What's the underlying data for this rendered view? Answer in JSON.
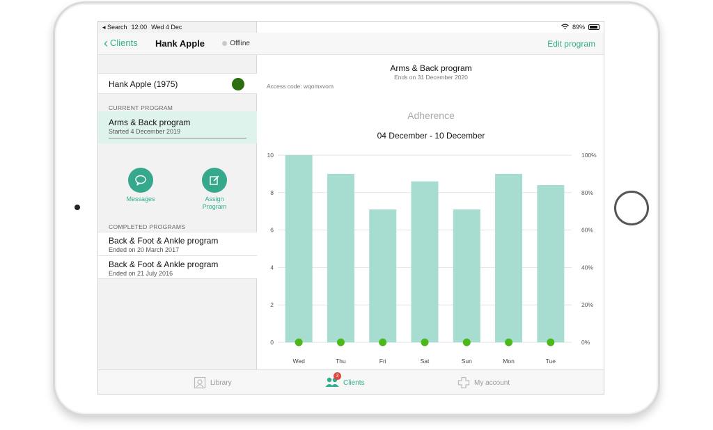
{
  "status_bar": {
    "back_app": "◂ Search",
    "time": "12:00",
    "date": "Wed 4 Dec",
    "battery": "89%"
  },
  "nav": {
    "back_label": "Clients",
    "title": "Hank Apple",
    "connection": "Offline",
    "edit_label": "Edit program"
  },
  "client": {
    "name": "Hank Apple (1975)",
    "status_color": "#2d6e0e"
  },
  "current_program": {
    "header": "CURRENT PROGRAM",
    "title": "Arms & Back program",
    "started": "Started 4 December 2019"
  },
  "actions": {
    "messages": "Messages",
    "assign_line1": "Assign",
    "assign_line2": "Program"
  },
  "completed": {
    "header": "COMPLETED PROGRAMS",
    "items": [
      {
        "title": "Back & Foot & Ankle program",
        "ended": "Ended on 20 March 2017"
      },
      {
        "title": "Back & Foot & Ankle program",
        "ended": "Ended on 21 July 2016"
      }
    ]
  },
  "program_detail": {
    "title": "Arms & Back program",
    "ends": "Ends on 31 December 2020",
    "access_code": "Access code: wqomxvom",
    "adherence_title": "Adherence",
    "range": "04 December - 10 December"
  },
  "chart_data": {
    "type": "bar",
    "categories": [
      "Wed",
      "Thu",
      "Fri",
      "Sat",
      "Sun",
      "Mon",
      "Tue"
    ],
    "values": [
      10,
      9,
      7.1,
      8.6,
      7.1,
      9,
      8.4
    ],
    "markers": [
      0,
      0,
      0,
      0,
      0,
      0,
      0
    ],
    "ylim": [
      0,
      10
    ],
    "y_ticks": [
      "0",
      "2",
      "4",
      "6",
      "8",
      "10"
    ],
    "y2_ticks": [
      "0%",
      "20%",
      "40%",
      "60%",
      "80%",
      "100%"
    ],
    "grid": true,
    "bar_color": "#a6ddd0",
    "marker_color": "#4cb81a"
  },
  "tabs": [
    {
      "label": "Library",
      "icon": "library-icon"
    },
    {
      "label": "Clients",
      "icon": "clients-icon",
      "badge": "3"
    },
    {
      "label": "My account",
      "icon": "account-icon"
    }
  ],
  "colors": {
    "accent": "#2fae8d"
  }
}
